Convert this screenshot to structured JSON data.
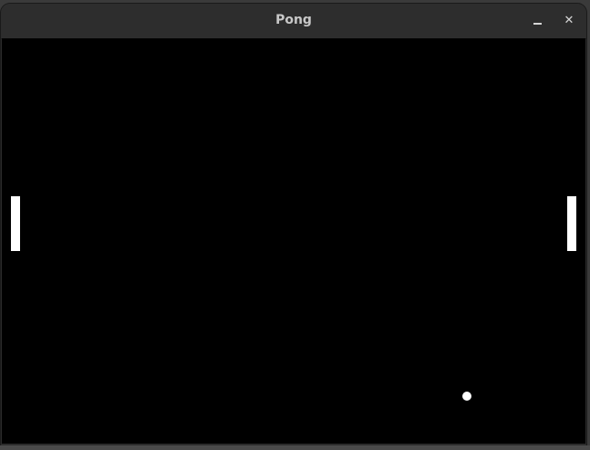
{
  "window": {
    "title": "Pong",
    "minimize_label": "Minimize",
    "close_glyph": "✕"
  },
  "game": {
    "background_color": "#000000",
    "paddle_color": "#ffffff",
    "ball_color": "#ffffff"
  }
}
